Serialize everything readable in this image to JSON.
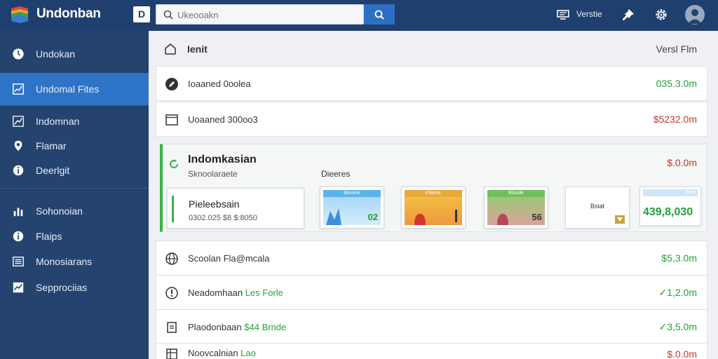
{
  "header": {
    "app_title": "Undonban",
    "d_label": "D",
    "search_placeholder": "Ukeooakn",
    "verbs_label": "Verstie"
  },
  "sidebar": {
    "items": [
      {
        "label": "Undokan",
        "icon": "clock-icon"
      },
      {
        "label": "Undomal Fites",
        "icon": "chart-icon",
        "active": true
      },
      {
        "label": "Indomnan",
        "icon": "trend-icon"
      },
      {
        "label": "Flamar",
        "icon": "pin-icon"
      },
      {
        "label": "Deerlgit",
        "icon": "info-icon"
      },
      {
        "label": "Sohonoian",
        "icon": "bar-chart-icon"
      },
      {
        "label": "Flaips",
        "icon": "info-icon"
      },
      {
        "label": "Monosiarans",
        "icon": "list-icon"
      },
      {
        "label": "Sepprociias",
        "icon": "chart-icon"
      }
    ]
  },
  "main": {
    "header_title": "Ienit",
    "header_right": "Versl Flm",
    "rows": [
      {
        "label": "Ioaaned 0oolea",
        "value": "035.3.0m",
        "tone": "pos"
      },
      {
        "label": "Uoaaned 300oo3",
        "value": "$5232.0m",
        "tone": "neg"
      }
    ],
    "panel": {
      "title": "Indomkasian",
      "subtitle": "Sknoolaraete",
      "middle": "Dieeres",
      "value": "$.0.0m",
      "detail_title": "Pieleebsain",
      "detail_sub": "0302.025 $8 $:8050",
      "thumbs": [
        {
          "head": "Bioome",
          "num": "02",
          "color": "#24a038"
        },
        {
          "head": "Flanne",
          "num": "",
          "color": "#333"
        },
        {
          "head": "Blonde",
          "num": "56",
          "color": "#333"
        }
      ],
      "mini_text": "Bsiat",
      "big_head": "Ame",
      "big_num": "439,8,030"
    },
    "rows2": [
      {
        "label": "Scoolan Fla@mcala",
        "green": "",
        "value": "$5,3.0m"
      },
      {
        "label": "Neadomhaan",
        "green": "Les Forle",
        "value": "✓1,2.0m"
      },
      {
        "label": "Plaodonbaan",
        "green": "$44 Brnde",
        "value": "✓3,5.0m"
      },
      {
        "label": "Noovcalnian",
        "green": "Lao",
        "value": "$.0.0m"
      }
    ]
  }
}
